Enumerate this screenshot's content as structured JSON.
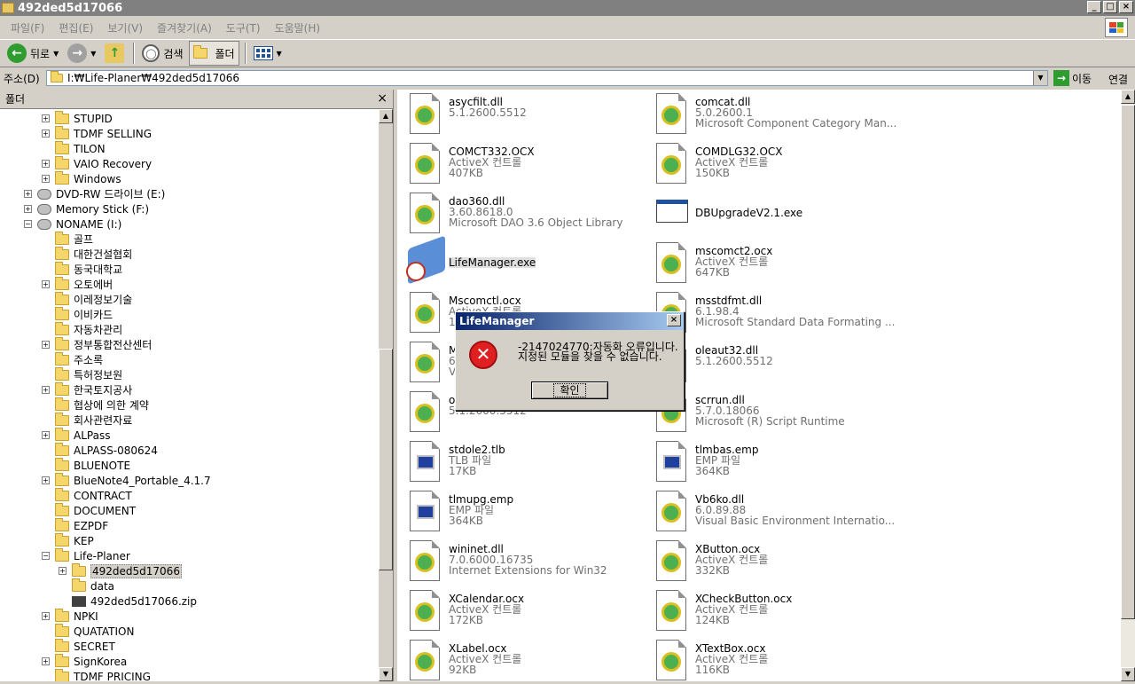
{
  "window": {
    "title": "492ded5d17066",
    "btn_min": "_",
    "btn_max": "□",
    "btn_close": "×"
  },
  "menu": [
    "파일(F)",
    "편집(E)",
    "보기(V)",
    "즐겨찾기(A)",
    "도구(T)",
    "도움말(H)"
  ],
  "toolbar": {
    "back": "뒤로",
    "search": "검색",
    "folders": "폴더"
  },
  "address": {
    "label": "주소(D)",
    "value": "I:₩Life-Planer₩492ded5d17066",
    "go": "이동",
    "links": "연결"
  },
  "folder_pane": {
    "title": "폴더",
    "close": "×",
    "items": [
      {
        "label": "STUPID",
        "level": 2,
        "exp": "+",
        "icon": "folder"
      },
      {
        "label": "TDMF SELLING",
        "level": 2,
        "exp": "+",
        "icon": "folder"
      },
      {
        "label": "TILON",
        "level": 2,
        "exp": "",
        "icon": "folder"
      },
      {
        "label": "VAIO Recovery",
        "level": 2,
        "exp": "+",
        "icon": "folder"
      },
      {
        "label": "Windows",
        "level": 2,
        "exp": "+",
        "icon": "folder"
      },
      {
        "label": "DVD-RW 드라이브 (E:)",
        "level": 1,
        "exp": "+",
        "icon": "drive"
      },
      {
        "label": "Memory Stick (F:)",
        "level": 1,
        "exp": "+",
        "icon": "drive"
      },
      {
        "label": "NONAME (I:)",
        "level": 1,
        "exp": "−",
        "icon": "drive"
      },
      {
        "label": "골프",
        "level": 2,
        "exp": "",
        "icon": "folder"
      },
      {
        "label": "대한건설협회",
        "level": 2,
        "exp": "",
        "icon": "folder"
      },
      {
        "label": "동국대학교",
        "level": 2,
        "exp": "",
        "icon": "folder"
      },
      {
        "label": "오토에버",
        "level": 2,
        "exp": "+",
        "icon": "folder"
      },
      {
        "label": "이레정보기술",
        "level": 2,
        "exp": "",
        "icon": "folder"
      },
      {
        "label": "이비카드",
        "level": 2,
        "exp": "",
        "icon": "folder"
      },
      {
        "label": "자동차관리",
        "level": 2,
        "exp": "",
        "icon": "folder"
      },
      {
        "label": "정부통합전산센터",
        "level": 2,
        "exp": "+",
        "icon": "folder"
      },
      {
        "label": "주소록",
        "level": 2,
        "exp": "",
        "icon": "folder"
      },
      {
        "label": "특허정보원",
        "level": 2,
        "exp": "",
        "icon": "folder"
      },
      {
        "label": "한국토지공사",
        "level": 2,
        "exp": "+",
        "icon": "folder"
      },
      {
        "label": "협상에 의한 계약",
        "level": 2,
        "exp": "",
        "icon": "folder"
      },
      {
        "label": "회사관련자료",
        "level": 2,
        "exp": "",
        "icon": "folder"
      },
      {
        "label": "ALPass",
        "level": 2,
        "exp": "+",
        "icon": "folder"
      },
      {
        "label": "ALPASS-080624",
        "level": 2,
        "exp": "",
        "icon": "folder"
      },
      {
        "label": "BLUENOTE",
        "level": 2,
        "exp": "",
        "icon": "folder"
      },
      {
        "label": "BlueNote4_Portable_4.1.7",
        "level": 2,
        "exp": "+",
        "icon": "folder"
      },
      {
        "label": "CONTRACT",
        "level": 2,
        "exp": "",
        "icon": "folder"
      },
      {
        "label": "DOCUMENT",
        "level": 2,
        "exp": "",
        "icon": "folder"
      },
      {
        "label": "EZPDF",
        "level": 2,
        "exp": "",
        "icon": "folder"
      },
      {
        "label": "KEP",
        "level": 2,
        "exp": "",
        "icon": "folder"
      },
      {
        "label": "Life-Planer",
        "level": 2,
        "exp": "−",
        "icon": "folder"
      },
      {
        "label": "492ded5d17066",
        "level": 3,
        "exp": "+",
        "icon": "folder",
        "selected": true
      },
      {
        "label": "data",
        "level": 3,
        "exp": "",
        "icon": "folder"
      },
      {
        "label": "492ded5d17066.zip",
        "level": 3,
        "exp": "",
        "icon": "zip"
      },
      {
        "label": "NPKI",
        "level": 2,
        "exp": "+",
        "icon": "folder"
      },
      {
        "label": "QUATATION",
        "level": 2,
        "exp": "",
        "icon": "folder"
      },
      {
        "label": "SECRET",
        "level": 2,
        "exp": "",
        "icon": "folder"
      },
      {
        "label": "SignKorea",
        "level": 2,
        "exp": "+",
        "icon": "folder"
      },
      {
        "label": "TDMF PRICING",
        "level": 2,
        "exp": "",
        "icon": "folder"
      }
    ]
  },
  "files": [
    {
      "name": "asycfilt.dll",
      "l2": "5.1.2600.5512",
      "l3": "",
      "icon": "gear"
    },
    {
      "name": "comcat.dll",
      "l2": "5.0.2600.1",
      "l3": "Microsoft Component Category Man...",
      "icon": "gear"
    },
    {
      "name": "COMCT332.OCX",
      "l2": "ActiveX 컨트롤",
      "l3": "407KB",
      "icon": "gear"
    },
    {
      "name": "COMDLG32.OCX",
      "l2": "ActiveX 컨트롤",
      "l3": "150KB",
      "icon": "gear"
    },
    {
      "name": "dao360.dll",
      "l2": "3.60.8618.0",
      "l3": "Microsoft DAO 3.6 Object Library",
      "icon": "gear"
    },
    {
      "name": "DBUpgradeV2.1.exe",
      "l2": "",
      "l3": "",
      "icon": "winexe"
    },
    {
      "name": "LifeManager.exe",
      "l2": "",
      "l3": "",
      "icon": "lifemgr"
    },
    {
      "name": "mscomct2.ocx",
      "l2": "ActiveX 컨트롤",
      "l3": "647KB",
      "icon": "gear"
    },
    {
      "name": "Mscomctl.ocx",
      "l2": "ActiveX 컨트롤",
      "l3": "1",
      "icon": "gear"
    },
    {
      "name": "msstdfmt.dll",
      "l2": "6.1.98.4",
      "l3": "Microsoft Standard Data Formating ...",
      "icon": "gear"
    },
    {
      "name": "M",
      "l2": "6",
      "l3": "V",
      "icon": "gear"
    },
    {
      "name": "oleaut32.dll",
      "l2": "5.1.2600.5512",
      "l3": "",
      "icon": "gear"
    },
    {
      "name": "o",
      "l2": "5.1.2600.5512",
      "l3": "",
      "icon": "gear"
    },
    {
      "name": "scrrun.dll",
      "l2": "5.7.0.18066",
      "l3": "Microsoft (R) Script Runtime",
      "icon": "gear"
    },
    {
      "name": "stdole2.tlb",
      "l2": "TLB 파일",
      "l3": "17KB",
      "icon": "emp"
    },
    {
      "name": "tlmbas.emp",
      "l2": "EMP 파일",
      "l3": "364KB",
      "icon": "emp"
    },
    {
      "name": "tlmupg.emp",
      "l2": "EMP 파일",
      "l3": "364KB",
      "icon": "emp"
    },
    {
      "name": "Vb6ko.dll",
      "l2": "6.0.89.88",
      "l3": "Visual Basic Environment Internatio...",
      "icon": "gear"
    },
    {
      "name": "wininet.dll",
      "l2": "7.0.6000.16735",
      "l3": "Internet Extensions for Win32",
      "icon": "gear"
    },
    {
      "name": "XButton.ocx",
      "l2": "ActiveX 컨트롤",
      "l3": "332KB",
      "icon": "gear"
    },
    {
      "name": "XCalendar.ocx",
      "l2": "ActiveX 컨트롤",
      "l3": "172KB",
      "icon": "gear"
    },
    {
      "name": "XCheckButton.ocx",
      "l2": "ActiveX 컨트롤",
      "l3": "124KB",
      "icon": "gear"
    },
    {
      "name": "XLabel.ocx",
      "l2": "ActiveX 컨트롤",
      "l3": "92KB",
      "icon": "gear"
    },
    {
      "name": "XTextBox.ocx",
      "l2": "ActiveX 컨트롤",
      "l3": "116KB",
      "icon": "gear"
    }
  ],
  "dialog": {
    "title": "LifeManager",
    "close": "×",
    "line1": "-2147024770:자동화 오류입니다.",
    "line2": "지정된 모듈을 찾을 수 없습니다.",
    "ok": "확인"
  }
}
